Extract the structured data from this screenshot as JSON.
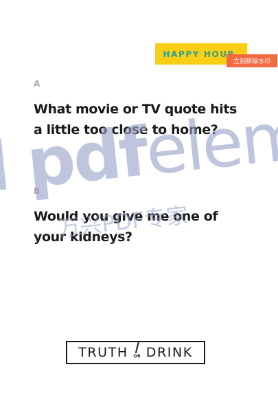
{
  "badge": {
    "label": "HAPPY HOUR"
  },
  "watermark_overlay": {
    "remove_label": "立刻移除水印",
    "brand_text_regular": "elem",
    "brand_text_bold": "pdf",
    "brand_text_prefix": "l",
    "sub_text": "万兴PDF专家"
  },
  "questions": [
    {
      "letter": "A",
      "text": "What movie or TV quote hits a little too close to home?"
    },
    {
      "letter": "B",
      "text": "Would you give me one of your kidneys?"
    }
  ],
  "logo": {
    "left_word": "TRUTH",
    "connector": "OR",
    "right_word": "DRINK"
  },
  "colors": {
    "badge_bg": "#f8cf15",
    "badge_text": "#2aa198",
    "remove_button_bg": "#f26a42",
    "question_text": "#1a1a1a",
    "letter_text": "#a8a8a8"
  }
}
